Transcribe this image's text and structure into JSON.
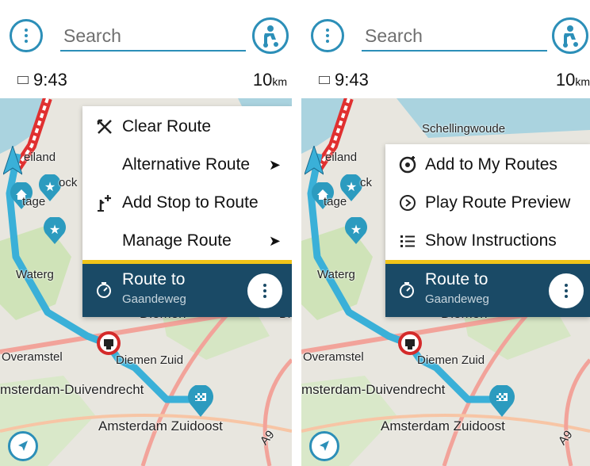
{
  "screens": [
    {
      "search_placeholder": "Search",
      "time": "9:43",
      "distance": "10",
      "distance_unit": "km",
      "menu": [
        {
          "label": "Clear Route",
          "icon": "clear-route-icon",
          "has_submenu": false
        },
        {
          "label": "Alternative Route",
          "icon": "",
          "has_submenu": true
        },
        {
          "label": "Add Stop to Route",
          "icon": "add-stop-icon",
          "has_submenu": false
        },
        {
          "label": "Manage Route",
          "icon": "",
          "has_submenu": true
        }
      ],
      "route": {
        "title": "Route to",
        "destination": "Gaandeweg"
      },
      "places": [
        "eiland",
        "ock",
        "tage",
        "Waterg",
        "Diemen",
        "Overamstel",
        "Diemen Zuid",
        "msterdam-Duivendrecht",
        "Amsterdam Zuidoost",
        "A9",
        "Di"
      ]
    },
    {
      "search_placeholder": "Search",
      "time": "9:43",
      "distance": "10",
      "distance_unit": "km",
      "menu": [
        {
          "label": "Add to My Routes",
          "icon": "my-routes-icon",
          "has_submenu": false
        },
        {
          "label": "Play Route Preview",
          "icon": "play-preview-icon",
          "has_submenu": false
        },
        {
          "label": "Show Instructions",
          "icon": "instructions-icon",
          "has_submenu": false
        }
      ],
      "route": {
        "title": "Route to",
        "destination": "Gaandeweg"
      },
      "places": [
        "Schellingwoude",
        "eiland",
        "ck",
        "tage",
        "Waterg",
        "Diemen",
        "Overamstel",
        "Diemen Zuid",
        "msterdam-Duivendrecht",
        "Amsterdam Zuidoost",
        "A9"
      ]
    }
  ],
  "colors": {
    "accent": "#2c8fb8",
    "route_panel": "#1a4a66",
    "route_panel_border": "#f0c419",
    "route_line": "#3ab0d8",
    "map_bg": "#e8e6df"
  }
}
